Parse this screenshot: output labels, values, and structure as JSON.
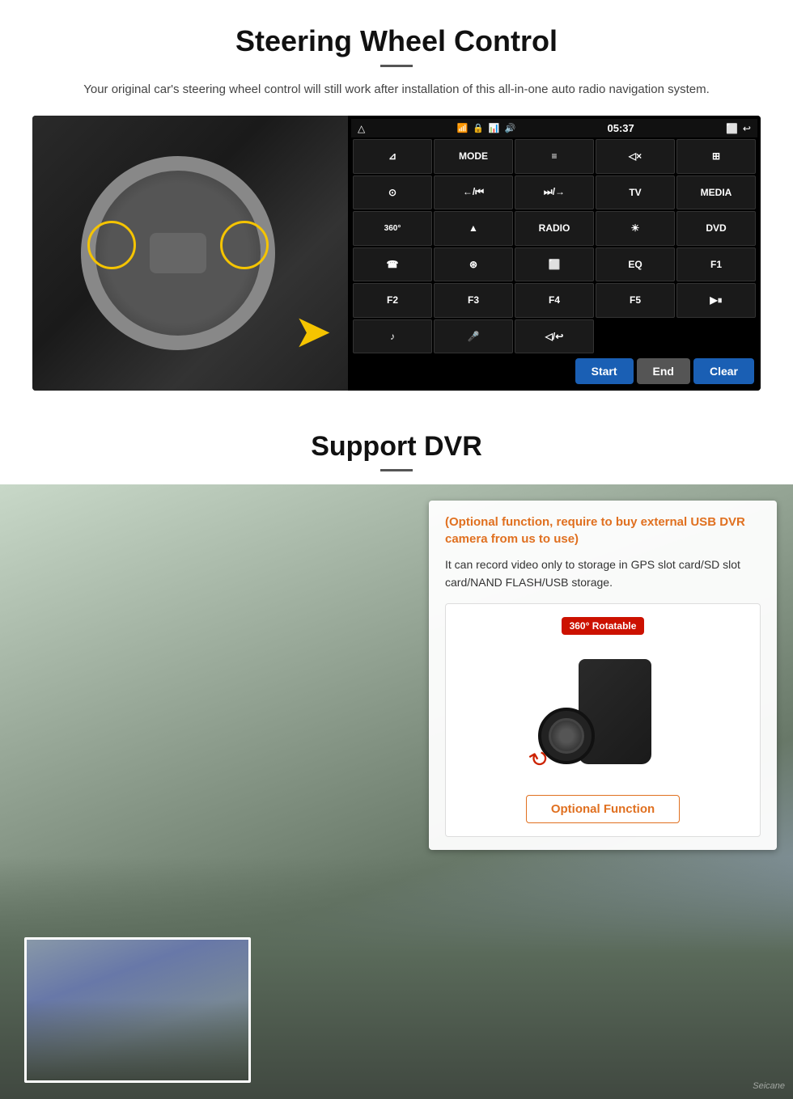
{
  "section1": {
    "title": "Steering Wheel Control",
    "description": "Your original car's steering wheel control will still work after installation of this all-in-one auto radio navigation system.",
    "time": "05:37",
    "ui_buttons": [
      {
        "id": "nav",
        "label": "⊿",
        "row": 1
      },
      {
        "id": "mode",
        "label": "MODE",
        "row": 1
      },
      {
        "id": "menu",
        "label": "≡",
        "row": 1
      },
      {
        "id": "mute",
        "label": "◁×",
        "row": 1
      },
      {
        "id": "dots",
        "label": "⊞",
        "row": 1
      },
      {
        "id": "settings",
        "label": "⊙",
        "row": 2
      },
      {
        "id": "prev",
        "label": "←/⏮",
        "row": 2
      },
      {
        "id": "next",
        "label": "⏭/→",
        "row": 2
      },
      {
        "id": "tv",
        "label": "TV",
        "row": 2
      },
      {
        "id": "media",
        "label": "MEDIA",
        "row": 2
      },
      {
        "id": "cam360",
        "label": "360°",
        "row": 3
      },
      {
        "id": "eject",
        "label": "▲",
        "row": 3
      },
      {
        "id": "radio",
        "label": "RADIO",
        "row": 3
      },
      {
        "id": "brightness",
        "label": "☀",
        "row": 3
      },
      {
        "id": "dvd",
        "label": "DVD",
        "row": 3
      },
      {
        "id": "phone",
        "label": "☎",
        "row": 4
      },
      {
        "id": "web",
        "label": "⊛",
        "row": 4
      },
      {
        "id": "screen",
        "label": "⬜",
        "row": 4
      },
      {
        "id": "eq",
        "label": "EQ",
        "row": 4
      },
      {
        "id": "f1",
        "label": "F1",
        "row": 4
      },
      {
        "id": "f2",
        "label": "F2",
        "row": 5
      },
      {
        "id": "f3",
        "label": "F3",
        "row": 5
      },
      {
        "id": "f4",
        "label": "F4",
        "row": 5
      },
      {
        "id": "f5",
        "label": "F5",
        "row": 5
      },
      {
        "id": "playpause",
        "label": "▶⏸",
        "row": 5
      },
      {
        "id": "music",
        "label": "♪",
        "row": 6
      },
      {
        "id": "mic",
        "label": "🎤",
        "row": 6
      },
      {
        "id": "volmute",
        "label": "◁/↩",
        "row": 6
      }
    ],
    "bottom_buttons": {
      "start": "Start",
      "end": "End",
      "clear": "Clear"
    }
  },
  "section2": {
    "title": "Support DVR",
    "optional_text": "(Optional function, require to buy external USB DVR camera from us to use)",
    "description": "It can record video only to storage in GPS slot card/SD slot card/NAND FLASH/USB storage.",
    "badge_360": "360° Rotatable",
    "optional_function_label": "Optional Function",
    "watermark": "Seicane"
  }
}
